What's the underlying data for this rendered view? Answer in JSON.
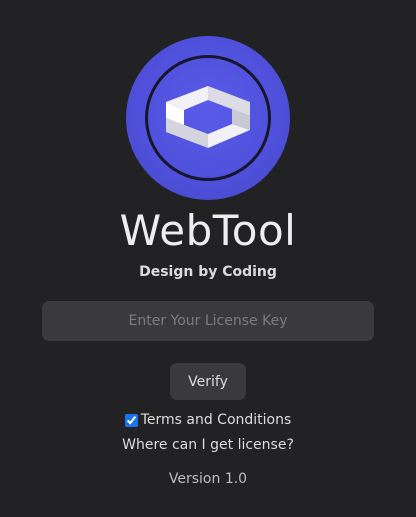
{
  "logo": {
    "icon": "webtool-logo-icon",
    "primary_color": "#5052df",
    "mark_color": "#e4e4ec"
  },
  "app": {
    "title": "WebTool",
    "subtitle": "Design by Coding",
    "version": "Version 1.0"
  },
  "license": {
    "placeholder": "Enter Your License Key",
    "value": ""
  },
  "actions": {
    "verify_label": "Verify",
    "terms_label": "Terms and Conditions",
    "terms_checked": true,
    "help_link": "Where can I get license?"
  }
}
